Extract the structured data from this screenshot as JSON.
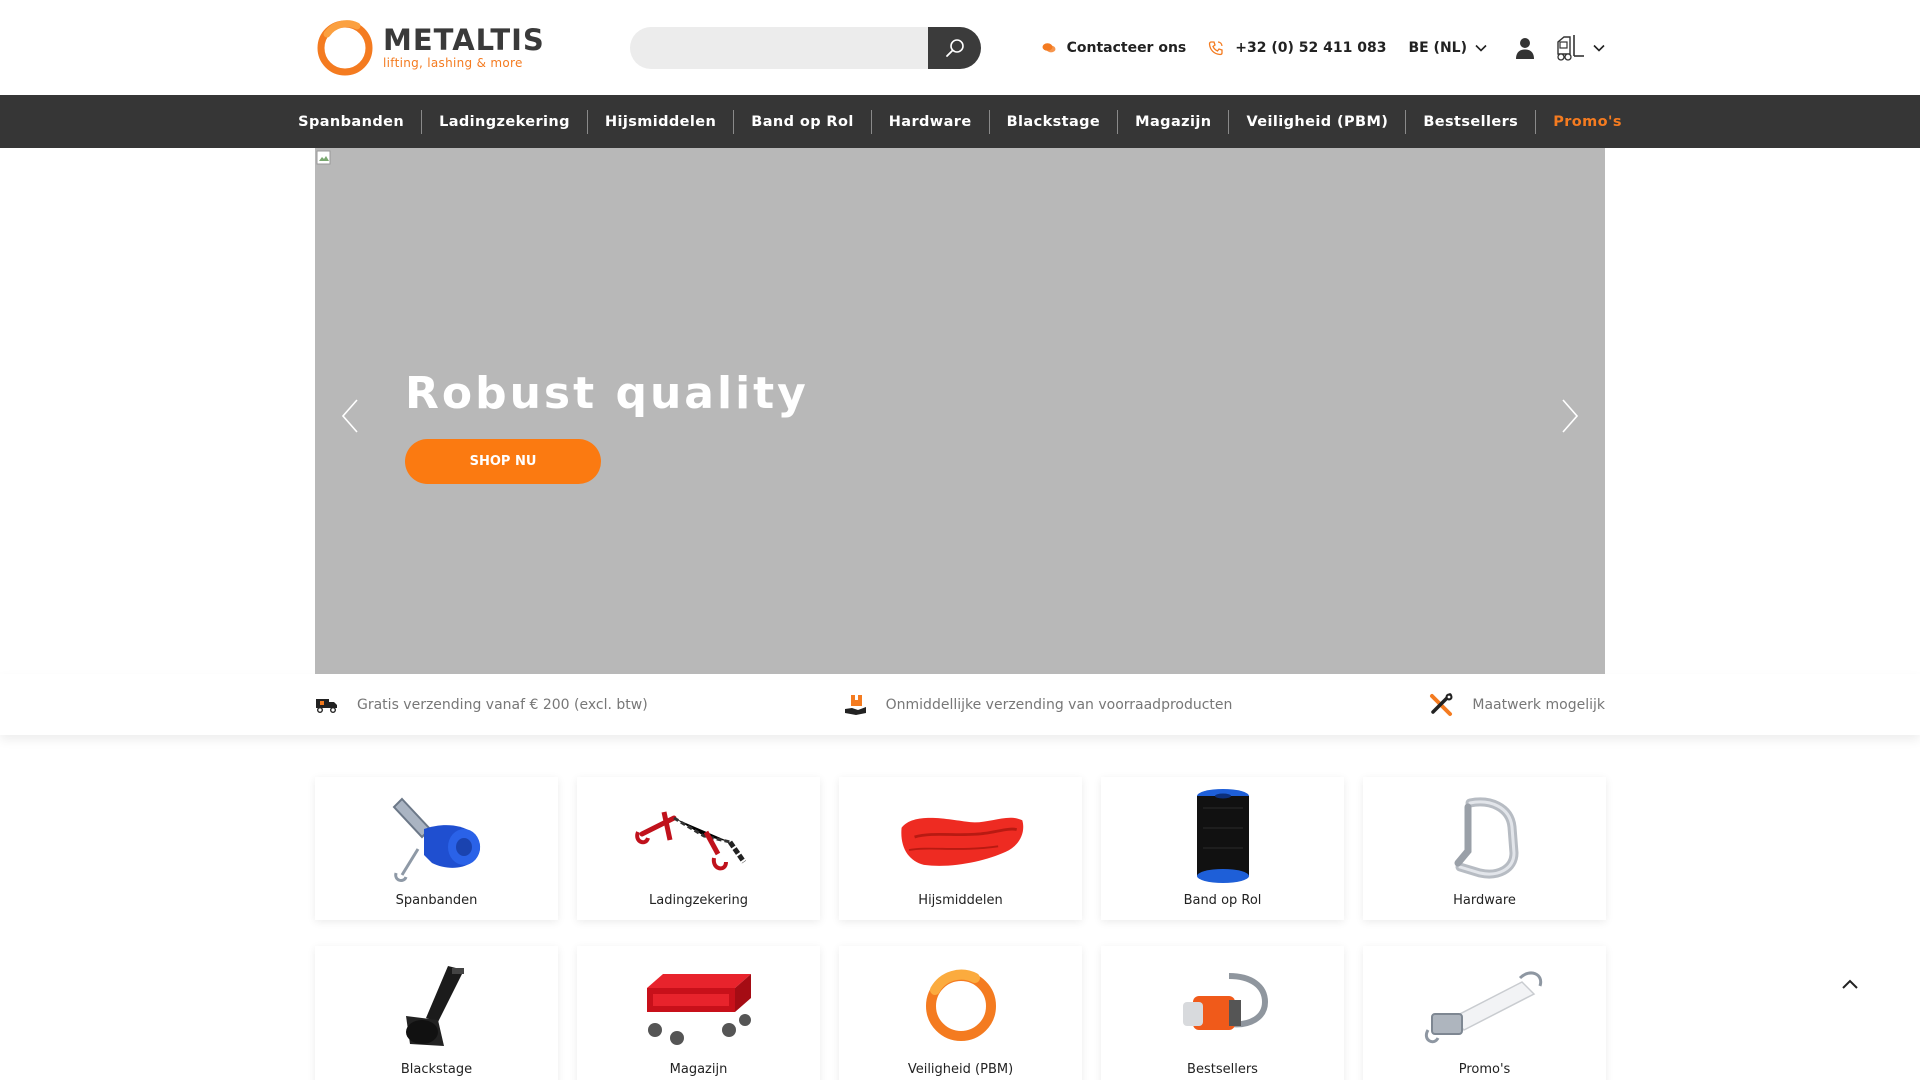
{
  "brand": {
    "name": "METALTIS",
    "tagline": "lifting, lashing & more",
    "accent": "#f47b20"
  },
  "search": {
    "placeholder": "",
    "button_icon": "search-icon"
  },
  "header": {
    "contact_label": "Contacteer ons",
    "phone": "+32 (0) 52 411 083",
    "language": "BE (NL)"
  },
  "nav": {
    "items": [
      {
        "label": "Spanbanden"
      },
      {
        "label": "Ladingzekering"
      },
      {
        "label": "Hijsmiddelen"
      },
      {
        "label": "Band op Rol"
      },
      {
        "label": "Hardware"
      },
      {
        "label": "Blackstage"
      },
      {
        "label": "Magazijn"
      },
      {
        "label": "Veiligheid (PBM)"
      },
      {
        "label": "Bestsellers"
      },
      {
        "label": "Promo's"
      }
    ]
  },
  "hero": {
    "title": "Robust quality",
    "button_label": "SHOP NU",
    "background": "#b8b8b8",
    "button_color": "#fb7a11"
  },
  "usp": {
    "items": [
      {
        "text": "Gratis verzending vanaf € 200 (excl. btw)",
        "icon": "truck-icon"
      },
      {
        "text": "Onmiddellijke verzending van voorraadproducten",
        "icon": "package-hand-icon"
      },
      {
        "text": "Maatwerk mogelijk",
        "icon": "tools-icon"
      }
    ]
  },
  "categories": [
    {
      "label": "Spanbanden"
    },
    {
      "label": "Ladingzekering"
    },
    {
      "label": "Hijsmiddelen"
    },
    {
      "label": "Band op Rol"
    },
    {
      "label": "Hardware"
    },
    {
      "label": "Blackstage"
    },
    {
      "label": "Magazijn"
    },
    {
      "label": "Veiligheid (PBM)"
    },
    {
      "label": "Bestsellers"
    },
    {
      "label": "Promo's"
    }
  ]
}
